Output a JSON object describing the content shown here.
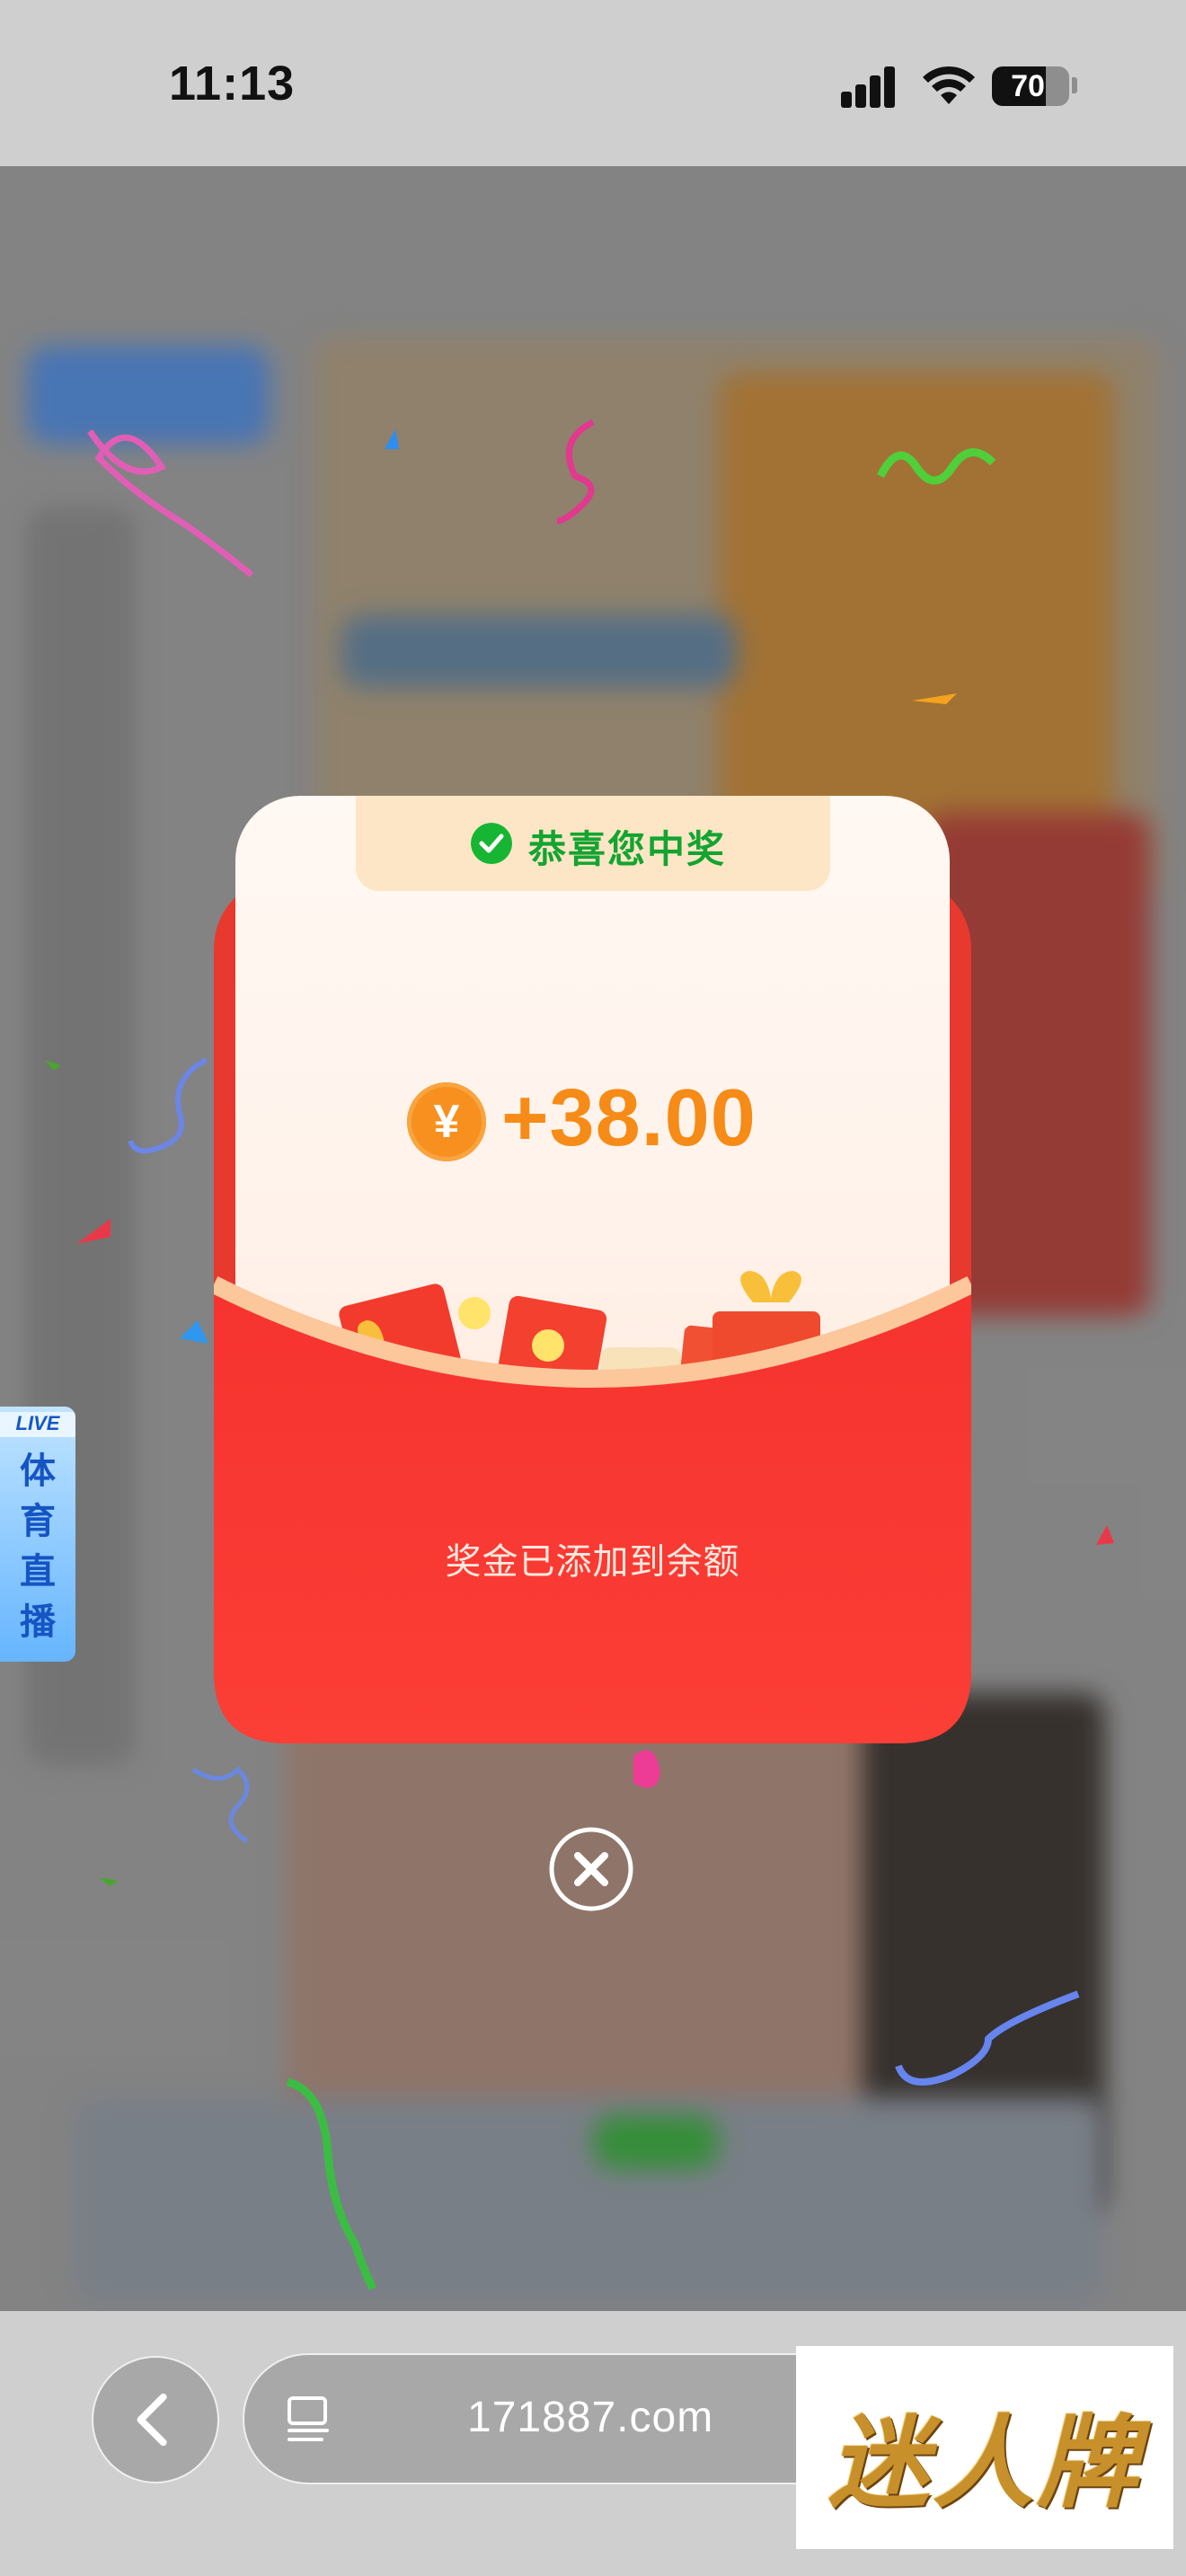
{
  "status_bar": {
    "time": "11:13",
    "battery": "70"
  },
  "side_widget": {
    "badge": "LIVE",
    "label": "体育直播"
  },
  "reward_card": {
    "header": "恭喜您中奖",
    "currency_symbol": "¥",
    "amount": "+38.00",
    "message": "奖金已添加到余额"
  },
  "browser": {
    "url": "171887.com"
  },
  "watermark": {
    "text": "迷人牌"
  },
  "colors": {
    "accent_red": "#e8392f",
    "amount_orange": "#f68b17",
    "success_green": "#13a431"
  },
  "icons": [
    "checkmark-icon",
    "yuan-coin-icon",
    "close-icon",
    "back-chevron-icon",
    "reader-icon",
    "wifi-icon"
  ]
}
